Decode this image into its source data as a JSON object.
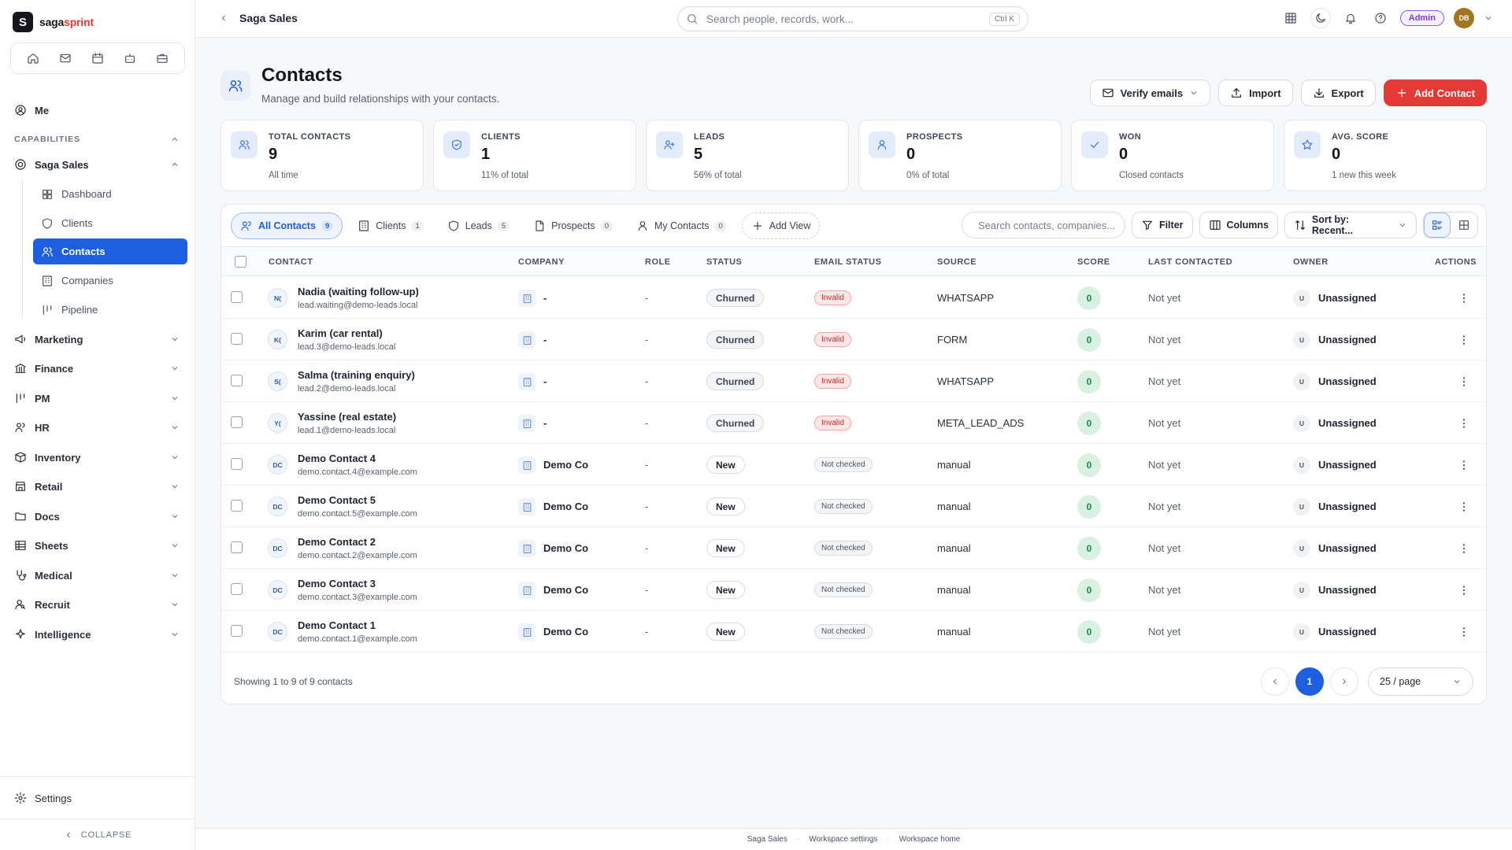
{
  "brand": {
    "name_part1": "saga",
    "name_part2": "sprint",
    "logo_letter": "S"
  },
  "sidebar": {
    "quick_icons": [
      "home-icon",
      "mail-icon",
      "calendar-icon",
      "bot-icon",
      "briefcase-icon"
    ],
    "me_label": "Me",
    "capabilities_label": "CAPABILITIES",
    "saga_sales_label": "Saga Sales",
    "sub_items": [
      {
        "label": "Dashboard",
        "icon": "grid-icon"
      },
      {
        "label": "Clients",
        "icon": "shield-icon"
      },
      {
        "label": "Contacts",
        "icon": "users-icon",
        "active": true
      },
      {
        "label": "Companies",
        "icon": "building-icon"
      },
      {
        "label": "Pipeline",
        "icon": "columns-icon"
      }
    ],
    "groups": [
      {
        "label": "Marketing",
        "icon": "megaphone-icon"
      },
      {
        "label": "Finance",
        "icon": "bank-icon"
      },
      {
        "label": "PM",
        "icon": "kanban-icon"
      },
      {
        "label": "HR",
        "icon": "people-icon"
      },
      {
        "label": "Inventory",
        "icon": "box-icon"
      },
      {
        "label": "Retail",
        "icon": "store-icon"
      },
      {
        "label": "Docs",
        "icon": "folder-icon"
      },
      {
        "label": "Sheets",
        "icon": "table-icon"
      },
      {
        "label": "Medical",
        "icon": "stethoscope-icon"
      },
      {
        "label": "Recruit",
        "icon": "user-search-icon"
      },
      {
        "label": "Intelligence",
        "icon": "sparkle-icon"
      }
    ],
    "settings_label": "Settings",
    "collapse_label": "COLLAPSE"
  },
  "topbar": {
    "breadcrumb": "Saga Sales",
    "search_placeholder": "Search people, records, work...",
    "search_shortcut": "Ctrl K",
    "admin_label": "Admin",
    "avatar_initials": "DB"
  },
  "page": {
    "title": "Contacts",
    "subtitle": "Manage and build relationships with your contacts.",
    "actions": {
      "verify": "Verify emails",
      "import": "Import",
      "export": "Export",
      "add": "Add Contact"
    }
  },
  "stats": [
    {
      "label": "TOTAL CONTACTS",
      "value": "9",
      "sub": "All time",
      "icon": "users-icon"
    },
    {
      "label": "CLIENTS",
      "value": "1",
      "sub": "11% of total",
      "icon": "shield-icon"
    },
    {
      "label": "LEADS",
      "value": "5",
      "sub": "56% of total",
      "icon": "user-plus-icon"
    },
    {
      "label": "PROSPECTS",
      "value": "0",
      "sub": "0% of total",
      "icon": "user-icon"
    },
    {
      "label": "WON",
      "value": "0",
      "sub": "Closed contacts",
      "icon": "check-icon"
    },
    {
      "label": "AVG. SCORE",
      "value": "0",
      "sub": "1 new this week",
      "icon": "star-icon"
    }
  ],
  "views": [
    {
      "label": "All Contacts",
      "count": "9",
      "active": true
    },
    {
      "label": "Clients",
      "count": "1"
    },
    {
      "label": "Leads",
      "count": "5"
    },
    {
      "label": "Prospects",
      "count": "0"
    },
    {
      "label": "My Contacts",
      "count": "0"
    }
  ],
  "add_view_label": "Add View",
  "toolbar": {
    "search_placeholder": "Search contacts, companies...",
    "filter": "Filter",
    "columns": "Columns",
    "sort": "Sort by: Recent..."
  },
  "columns": [
    "CONTACT",
    "COMPANY",
    "ROLE",
    "STATUS",
    "EMAIL STATUS",
    "SOURCE",
    "SCORE",
    "LAST CONTACTED",
    "OWNER",
    "ACTIONS"
  ],
  "rows": [
    {
      "initials": "N(",
      "name": "Nadia (waiting follow-up)",
      "email": "lead.waiting@demo-leads.local",
      "company": "-",
      "role": "-",
      "status": "Churned",
      "email_status": "Invalid",
      "source": "WHATSAPP",
      "score": "0",
      "last": "Not yet",
      "owner_initial": "U",
      "owner": "Unassigned"
    },
    {
      "initials": "K(",
      "name": "Karim (car rental)",
      "email": "lead.3@demo-leads.local",
      "company": "-",
      "role": "-",
      "status": "Churned",
      "email_status": "Invalid",
      "source": "FORM",
      "score": "0",
      "last": "Not yet",
      "owner_initial": "U",
      "owner": "Unassigned"
    },
    {
      "initials": "S(",
      "name": "Salma (training enquiry)",
      "email": "lead.2@demo-leads.local",
      "company": "-",
      "role": "-",
      "status": "Churned",
      "email_status": "Invalid",
      "source": "WHATSAPP",
      "score": "0",
      "last": "Not yet",
      "owner_initial": "U",
      "owner": "Unassigned"
    },
    {
      "initials": "Y(",
      "name": "Yassine (real estate)",
      "email": "lead.1@demo-leads.local",
      "company": "-",
      "role": "-",
      "status": "Churned",
      "email_status": "Invalid",
      "source": "META_LEAD_ADS",
      "score": "0",
      "last": "Not yet",
      "owner_initial": "U",
      "owner": "Unassigned"
    },
    {
      "initials": "DC",
      "name": "Demo Contact 4",
      "email": "demo.contact.4@example.com",
      "company": "Demo Co",
      "role": "-",
      "status": "New",
      "email_status": "Not checked",
      "source": "manual",
      "score": "0",
      "last": "Not yet",
      "owner_initial": "U",
      "owner": "Unassigned"
    },
    {
      "initials": "DC",
      "name": "Demo Contact 5",
      "email": "demo.contact.5@example.com",
      "company": "Demo Co",
      "role": "-",
      "status": "New",
      "email_status": "Not checked",
      "source": "manual",
      "score": "0",
      "last": "Not yet",
      "owner_initial": "U",
      "owner": "Unassigned"
    },
    {
      "initials": "DC",
      "name": "Demo Contact 2",
      "email": "demo.contact.2@example.com",
      "company": "Demo Co",
      "role": "-",
      "status": "New",
      "email_status": "Not checked",
      "source": "manual",
      "score": "0",
      "last": "Not yet",
      "owner_initial": "U",
      "owner": "Unassigned"
    },
    {
      "initials": "DC",
      "name": "Demo Contact 3",
      "email": "demo.contact.3@example.com",
      "company": "Demo Co",
      "role": "-",
      "status": "New",
      "email_status": "Not checked",
      "source": "manual",
      "score": "0",
      "last": "Not yet",
      "owner_initial": "U",
      "owner": "Unassigned"
    },
    {
      "initials": "DC",
      "name": "Demo Contact 1",
      "email": "demo.contact.1@example.com",
      "company": "Demo Co",
      "role": "-",
      "status": "New",
      "email_status": "Not checked",
      "source": "manual",
      "score": "0",
      "last": "Not yet",
      "owner_initial": "U",
      "owner": "Unassigned"
    }
  ],
  "pagination": {
    "showing": "Showing 1 to 9 of 9 contacts",
    "current_page": "1",
    "per_page": "25 / page"
  },
  "footer": {
    "links": [
      "Saga Sales",
      "Workspace settings",
      "Workspace home"
    ]
  },
  "colors": {
    "accent": "#1d5fe0",
    "danger": "#e53935",
    "admin": "#7c3aed"
  }
}
